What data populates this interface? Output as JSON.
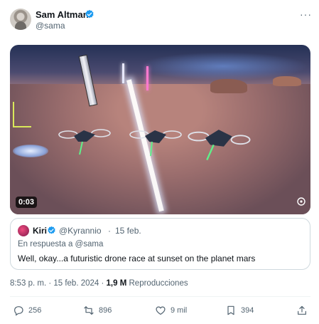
{
  "author": {
    "name": "Sam Altman",
    "handle": "@sama"
  },
  "menu": {
    "more_label": "···"
  },
  "media": {
    "duration": "0:03"
  },
  "quote": {
    "name": "Kiri",
    "handle": "@Kyrannio",
    "separator": "·",
    "date": "15 feb.",
    "reply_to": "En respuesta a @sama",
    "text": "Well, okay...a futuristic drone race at sunset on the planet mars"
  },
  "meta": {
    "time_date": "8:53 p. m. · 15 feb. 2024 · ",
    "views_count": "1,9 M",
    "views_label": " Reproducciones"
  },
  "actions": {
    "replies": "256",
    "reposts": "896",
    "likes": "9 mil",
    "bookmarks": "394"
  },
  "colors": {
    "verified": "#1d9bf0",
    "secondary_text": "#536471",
    "border": "#cfd9de"
  },
  "icons": {
    "verified": "verified-badge-icon",
    "reply": "reply-icon",
    "repost": "repost-icon",
    "like": "heart-icon",
    "bookmark": "bookmark-icon",
    "share": "share-icon"
  }
}
